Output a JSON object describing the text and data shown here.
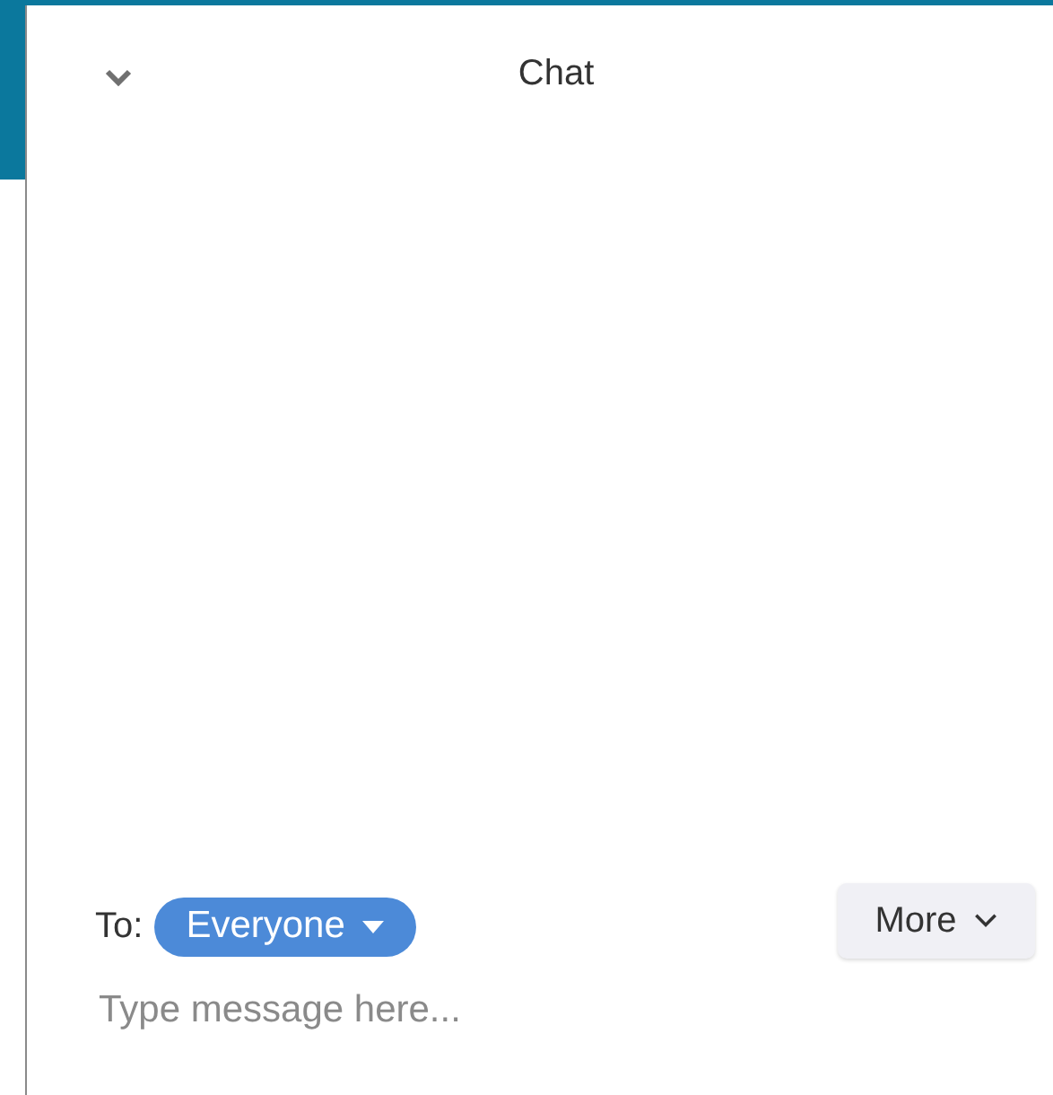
{
  "panel": {
    "title": "Chat"
  },
  "recipient": {
    "label": "To:",
    "value": "Everyone"
  },
  "more_button": {
    "label": "More"
  },
  "message_field": {
    "placeholder": "Type message here..."
  }
}
